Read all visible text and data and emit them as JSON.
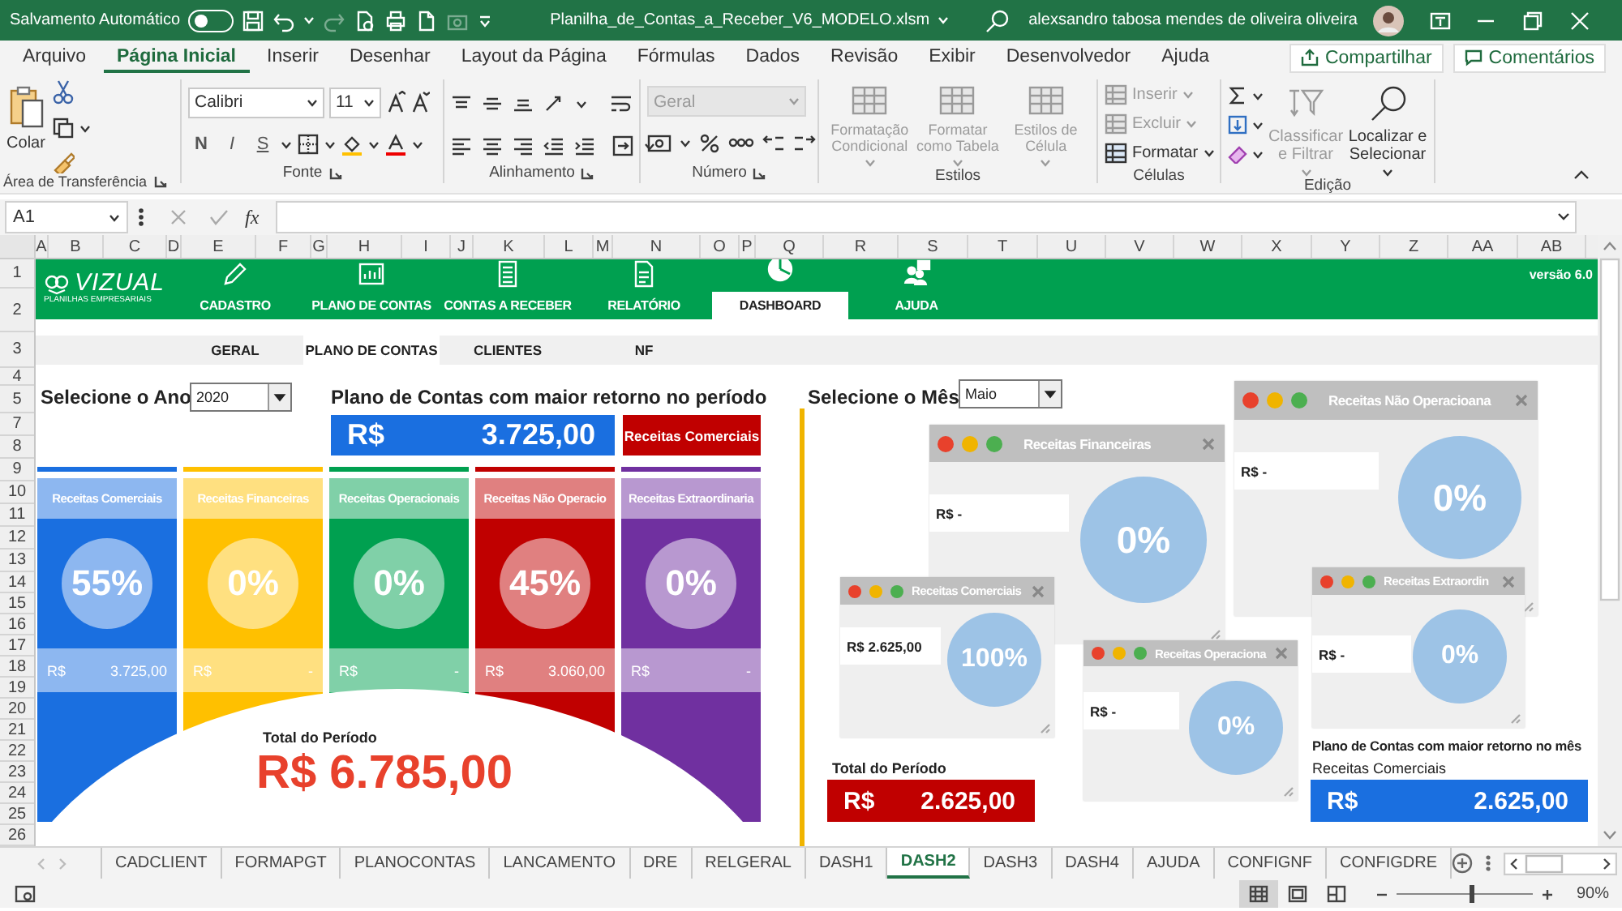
{
  "title_bar": {
    "autosave_label": "Salvamento Automático",
    "autosave_on": false,
    "filename": "Planilha_de_Contas_a_Receber_V6_MODELO.xlsm",
    "user": "alexsandro tabosa mendes de oliveira oliveira"
  },
  "ribbon_tabs": [
    {
      "label": "Arquivo",
      "selected": false
    },
    {
      "label": "Página Inicial",
      "selected": true
    },
    {
      "label": "Inserir",
      "selected": false
    },
    {
      "label": "Desenhar",
      "selected": false
    },
    {
      "label": "Layout da Página",
      "selected": false
    },
    {
      "label": "Fórmulas",
      "selected": false
    },
    {
      "label": "Dados",
      "selected": false
    },
    {
      "label": "Revisão",
      "selected": false
    },
    {
      "label": "Exibir",
      "selected": false
    },
    {
      "label": "Desenvolvedor",
      "selected": false
    },
    {
      "label": "Ajuda",
      "selected": false
    }
  ],
  "share_button": "Compartilhar",
  "comments_button": "Comentários",
  "ribbon": {
    "clipboard": {
      "label": "Área de Transferência",
      "paste": "Colar"
    },
    "font": {
      "label": "Fonte",
      "font_name": "Calibri",
      "font_size": "11",
      "style_buttons": [
        "N",
        "I",
        "S"
      ]
    },
    "alignment": {
      "label": "Alinhamento"
    },
    "number": {
      "label": "Número",
      "format": "Geral",
      "disabled": true
    },
    "styles": {
      "label": "Estilos",
      "commands": [
        {
          "label": "Formatação Condicional",
          "disabled": true
        },
        {
          "label": "Formatar como Tabela",
          "disabled": true
        },
        {
          "label": "Estilos de Célula",
          "disabled": true
        }
      ]
    },
    "cells": {
      "label": "Células",
      "commands": [
        {
          "label": "Inserir",
          "disabled": true
        },
        {
          "label": "Excluir",
          "disabled": true
        },
        {
          "label": "Formatar",
          "disabled": false
        }
      ]
    },
    "editing": {
      "label": "Edição",
      "commands": [
        {
          "label": "Classificar e Filtrar",
          "disabled": true
        },
        {
          "label": "Localizar e Selecionar",
          "disabled": false
        }
      ]
    }
  },
  "formula_bar": {
    "name_box": "A1",
    "function_button": "fx"
  },
  "columns": [
    "A",
    "B",
    "C",
    "D",
    "E",
    "F",
    "G",
    "H",
    "I",
    "J",
    "K",
    "L",
    "M",
    "N",
    "O",
    "P",
    "Q",
    "R",
    "S",
    "T",
    "U",
    "V",
    "W",
    "X",
    "Y",
    "Z",
    "AA",
    "AB"
  ],
  "rows": [
    "1",
    "2",
    "3",
    "4",
    "5",
    "7",
    "8",
    "9",
    "10",
    "11",
    "12",
    "13",
    "14",
    "15",
    "16",
    "17",
    "18",
    "19",
    "20",
    "21",
    "22",
    "23",
    "24",
    "25",
    "26"
  ],
  "dashboard": {
    "logo": {
      "name": "VIZUAL",
      "tagline": "PLANILHAS EMPRESARIAIS"
    },
    "version": "versão 6.0",
    "nav": [
      {
        "label": "CADASTRO",
        "kind": "pencil",
        "selected": false
      },
      {
        "label": "PLANO DE CONTAS",
        "kind": "chart",
        "selected": false
      },
      {
        "label": "CONTAS A RECEBER",
        "kind": "calculator",
        "selected": false
      },
      {
        "label": "RELATÓRIO",
        "kind": "document",
        "selected": false
      },
      {
        "label": "DASHBOARD",
        "kind": "pie",
        "selected": true
      },
      {
        "label": "AJUDA",
        "kind": "help",
        "selected": false
      }
    ],
    "subtabs": [
      {
        "label": "GERAL",
        "selected": false
      },
      {
        "label": "PLANO DE CONTAS",
        "selected": true
      },
      {
        "label": "CLIENTES",
        "selected": false
      },
      {
        "label": "NF",
        "selected": false
      }
    ],
    "year": {
      "label": "Selecione o Ano",
      "value": "2020"
    },
    "top_account": {
      "heading": "Plano de Contas com maior retorno no período",
      "currency": "R$",
      "amount": "3.725,00",
      "account": "Receitas Comerciais"
    },
    "cards": [
      {
        "title": "Receitas Comerciais",
        "percent": "55%",
        "currency": "R$",
        "amount": "3.725,00",
        "color": "#1a6fe0"
      },
      {
        "title": "Receitas Financeiras",
        "percent": "0%",
        "currency": "R$",
        "amount": "-",
        "color": "#ffc000"
      },
      {
        "title": "Receitas Operacionais",
        "percent": "0%",
        "currency": "R$",
        "amount": "-",
        "color": "#00a050"
      },
      {
        "title": "Receitas Não Operacio",
        "percent": "45%",
        "currency": "R$",
        "amount": "3.060,00",
        "color": "#c00000"
      },
      {
        "title": "Receitas Extraordinaria",
        "percent": "0%",
        "currency": "R$",
        "amount": "-",
        "color": "#7030a0"
      }
    ],
    "total": {
      "label": "Total do Período",
      "amount": "R$ 6.785,00"
    },
    "month": {
      "label": "Selecione o Mês",
      "value": "Maio"
    },
    "windows": [
      {
        "title": "Receitas Não Operacioana",
        "amount": "R$ -",
        "percent": "0%"
      },
      {
        "title": "Receitas Financeiras",
        "amount": "R$ -",
        "percent": "0%"
      },
      {
        "title": "Receitas Comerciais",
        "amount": "R$ 2.625,00",
        "percent": "100%"
      },
      {
        "title": "Receitas Extraordin",
        "amount": "R$ -",
        "percent": "0%"
      },
      {
        "title": "Receitas Operaciona",
        "amount": "R$ -",
        "percent": "0%"
      }
    ],
    "month_total": {
      "label": "Total do Período",
      "currency": "R$",
      "amount": "2.625,00"
    },
    "month_top": {
      "heading": "Plano de Contas com maior retorno no mês",
      "account": "Receitas Comerciais",
      "currency": "R$",
      "amount": "2.625,00"
    }
  },
  "sheet_tabs": [
    {
      "label": "CADCLIENT",
      "selected": false
    },
    {
      "label": "FORMAPGT",
      "selected": false
    },
    {
      "label": "PLANOCONTAS",
      "selected": false
    },
    {
      "label": "LANCAMENTO",
      "selected": false
    },
    {
      "label": "DRE",
      "selected": false
    },
    {
      "label": "RELGERAL",
      "selected": false
    },
    {
      "label": "DASH1",
      "selected": false
    },
    {
      "label": "DASH2",
      "selected": true
    },
    {
      "label": "DASH3",
      "selected": false
    },
    {
      "label": "DASH4",
      "selected": false
    },
    {
      "label": "AJUDA",
      "selected": false
    },
    {
      "label": "CONFIGNF",
      "selected": false
    },
    {
      "label": "CONFIGDRE",
      "selected": false
    }
  ],
  "status_bar": {
    "view_buttons": [
      {
        "kind": "normal",
        "selected": true
      },
      {
        "kind": "page_layout",
        "selected": false
      },
      {
        "kind": "page_break",
        "selected": false
      }
    ],
    "zoom": {
      "level": 0.55,
      "reading": "90%"
    }
  }
}
